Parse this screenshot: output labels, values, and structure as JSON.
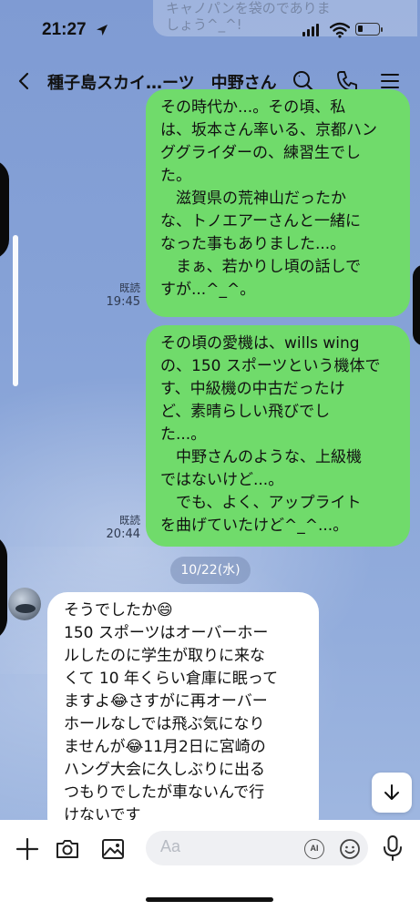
{
  "status_bar": {
    "time": "21:27"
  },
  "ghost_notification": {
    "line1": "キャノパンを袋のでありま",
    "line2": "しょう^_^!"
  },
  "header": {
    "title": "種子島スカイ…ーツ　中野さん"
  },
  "messages": {
    "out1": {
      "text": "その時代か...。その頃、私\nは、坂本さん率いる、京都ハン\nググライダーの、練習生でし\nた。\n　滋賀県の荒神山だったか\nな、トノエアーさんと一緒に\nなった事もありました...。\n　まぁ、若かりし頃の話しで\nすが...^_^。",
      "read": "既読",
      "time": "19:45"
    },
    "out2": {
      "text": "その頃の愛機は、wills wing\nの、150 スポーツという機体で\nす、中級機の中古だったけ\nど、素晴らしい飛びでし\nた...。\n　中野さんのような、上級機\nではないけど...。\n　でも、よく、アップライト\nを曲げていたけど^_^...。",
      "read": "既読",
      "time": "20:44"
    },
    "date_separator": "10/22(水)",
    "in1": {
      "text": "そうでしたか😄\n150 スポーツはオーバーホー\nルしたのに学生が取りに来な\nくて 10 年くらい倉庫に眠って\nますよ😂さすがに再オーバー\nホールなしでは飛ぶ気になり\nませんが😂11月2日に宮崎の\nハング大会に久しぶりに出る\nつもりでしたが車ないんで行\nけないです"
    }
  },
  "input": {
    "placeholder": "Aa",
    "ai_label": "AI"
  },
  "icons": {
    "back": "chevron-left-icon",
    "search": "search-icon",
    "call": "phone-icon",
    "menu": "hamburger-menu-icon",
    "plus": "plus-icon",
    "camera": "camera-icon",
    "image": "image-icon",
    "emoji": "emoji-icon",
    "mic": "microphone-icon",
    "scroll_down": "arrow-down-icon"
  },
  "colors": {
    "outgoing_bubble": "#70db6b",
    "incoming_bubble": "#ffffff",
    "chat_background": "#7f9bd3"
  }
}
